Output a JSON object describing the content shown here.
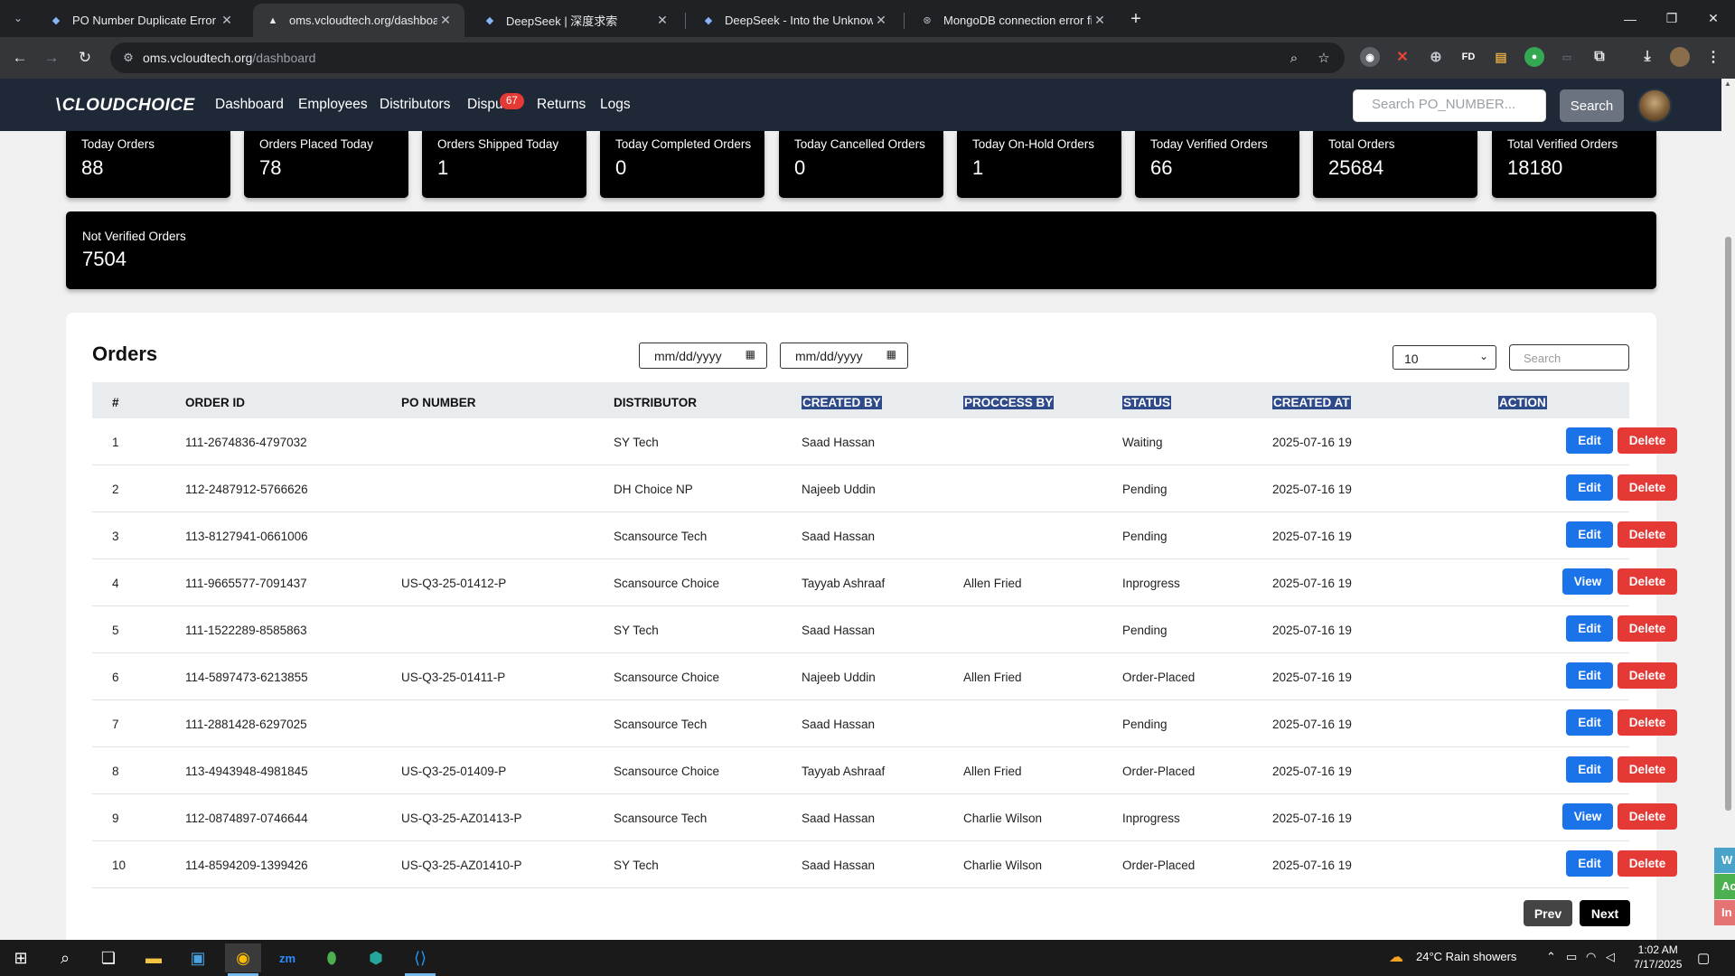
{
  "browser": {
    "tabs": [
      {
        "title": "PO Number Duplicate Error Exp",
        "active": false
      },
      {
        "title": "oms.vcloudtech.org/dashboard",
        "active": true
      },
      {
        "title": "DeepSeek | 深度求索",
        "active": false
      },
      {
        "title": "DeepSeek - Into the Unknown",
        "active": false
      },
      {
        "title": "MongoDB connection error fix",
        "active": false
      }
    ],
    "url_host": "oms.vcloudtech.org",
    "url_path": "/dashboard",
    "extensions": [
      "FD"
    ]
  },
  "app": {
    "logo": "CLOUDCHOICE",
    "nav": [
      "Dashboard",
      "Employees",
      "Distributors",
      "Dispu",
      "Returns",
      "Logs"
    ],
    "disputes_badge": "67",
    "search_placeholder": "Search PO_NUMBER...",
    "search_button": "Search"
  },
  "stats": [
    {
      "label": "Today Orders",
      "value": "88"
    },
    {
      "label": "Orders Placed Today",
      "value": "78"
    },
    {
      "label": "Orders Shipped Today",
      "value": "1"
    },
    {
      "label": "Today Completed Orders",
      "value": "0"
    },
    {
      "label": "Today Cancelled Orders",
      "value": "0"
    },
    {
      "label": "Today On-Hold Orders",
      "value": "1"
    },
    {
      "label": "Today Verified Orders",
      "value": "66"
    },
    {
      "label": "Total Orders",
      "value": "25684"
    },
    {
      "label": "Total Verified Orders",
      "value": "18180"
    }
  ],
  "not_verified": {
    "label": "Not Verified Orders",
    "value": "7504"
  },
  "orders": {
    "title": "Orders",
    "date_from": "mm/dd/yyyy",
    "date_to": "mm/dd/yyyy",
    "page_size": "10",
    "search_placeholder": "Search",
    "columns": [
      "#",
      "ORDER ID",
      "PO NUMBER",
      "DISTRIBUTOR",
      "CREATED BY",
      "PROCCESS BY",
      "STATUS",
      "CREATED AT",
      "ACTION"
    ],
    "rows": [
      {
        "num": "1",
        "order_id": "111-2674836-4797032",
        "po": "",
        "distributor": "SY Tech",
        "created_by": "Saad Hassan",
        "process_by": "",
        "status": "Waiting",
        "created_at": "2025-07-16 19",
        "action": "Edit"
      },
      {
        "num": "2",
        "order_id": "112-2487912-5766626",
        "po": "",
        "distributor": "DH Choice NP",
        "created_by": "Najeeb Uddin",
        "process_by": "",
        "status": "Pending",
        "created_at": "2025-07-16 19",
        "action": "Edit"
      },
      {
        "num": "3",
        "order_id": "113-8127941-0661006",
        "po": "",
        "distributor": "Scansource Tech",
        "created_by": "Saad Hassan",
        "process_by": "",
        "status": "Pending",
        "created_at": "2025-07-16 19",
        "action": "Edit"
      },
      {
        "num": "4",
        "order_id": "111-9665577-7091437",
        "po": "US-Q3-25-01412-P",
        "distributor": "Scansource Choice",
        "created_by": "Tayyab Ashraaf",
        "process_by": "Allen Fried",
        "status": "Inprogress",
        "created_at": "2025-07-16 19",
        "action": "View"
      },
      {
        "num": "5",
        "order_id": "111-1522289-8585863",
        "po": "",
        "distributor": "SY Tech",
        "created_by": "Saad Hassan",
        "process_by": "",
        "status": "Pending",
        "created_at": "2025-07-16 19",
        "action": "Edit"
      },
      {
        "num": "6",
        "order_id": "114-5897473-6213855",
        "po": "US-Q3-25-01411-P",
        "distributor": "Scansource Choice",
        "created_by": "Najeeb Uddin",
        "process_by": "Allen Fried",
        "status": "Order-Placed",
        "created_at": "2025-07-16 19",
        "action": "Edit"
      },
      {
        "num": "7",
        "order_id": "111-2881428-6297025",
        "po": "",
        "distributor": "Scansource Tech",
        "created_by": "Saad Hassan",
        "process_by": "",
        "status": "Pending",
        "created_at": "2025-07-16 19",
        "action": "Edit"
      },
      {
        "num": "8",
        "order_id": "113-4943948-4981845",
        "po": "US-Q3-25-01409-P",
        "distributor": "Scansource Choice",
        "created_by": "Tayyab Ashraaf",
        "process_by": "Allen Fried",
        "status": "Order-Placed",
        "created_at": "2025-07-16 19",
        "action": "Edit"
      },
      {
        "num": "9",
        "order_id": "112-0874897-0746644",
        "po": "US-Q3-25-AZ01413-P",
        "distributor": "Scansource Tech",
        "created_by": "Saad Hassan",
        "process_by": "Charlie Wilson",
        "status": "Inprogress",
        "created_at": "2025-07-16 19",
        "action": "View"
      },
      {
        "num": "10",
        "order_id": "114-8594209-1399426",
        "po": "US-Q3-25-AZ01410-P",
        "distributor": "SY Tech",
        "created_by": "Saad Hassan",
        "process_by": "Charlie Wilson",
        "status": "Order-Placed",
        "created_at": "2025-07-16 19",
        "action": "Edit"
      }
    ],
    "delete_label": "Delete",
    "prev_label": "Prev",
    "next_label": "Next"
  },
  "side_tabs": [
    "W",
    "Ac",
    "In"
  ],
  "taskbar": {
    "weather": "24°C  Rain showers",
    "time": "1:02 AM",
    "date": "7/17/2025"
  },
  "colors": {
    "appbar": "#1e2836",
    "card": "#000000",
    "edit": "#1a73e8",
    "delete": "#e53935",
    "header_highlight": "#2f4a8a"
  }
}
